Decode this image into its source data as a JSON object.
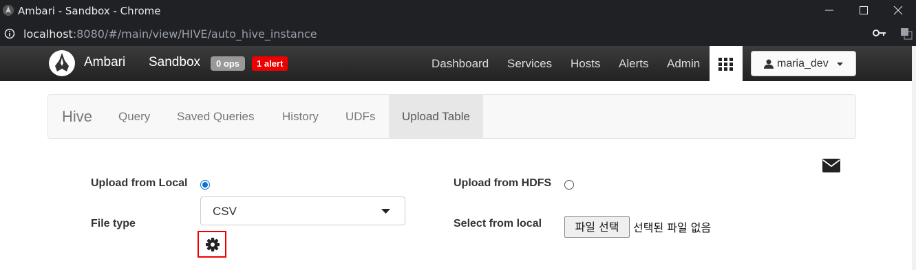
{
  "window": {
    "title": "Ambari - Sandbox - Chrome"
  },
  "browser": {
    "url_host": "localhost",
    "url_path": ":8080/#/main/view/HIVE/auto_hive_instance"
  },
  "navbar": {
    "brand": "Ambari",
    "cluster": "Sandbox",
    "ops_badge": "0 ops",
    "alert_badge": "1 alert",
    "links": [
      "Dashboard",
      "Services",
      "Hosts",
      "Alerts",
      "Admin"
    ],
    "user": "maria_dev"
  },
  "hive_nav": {
    "brand": "Hive",
    "tabs": [
      "Query",
      "Saved Queries",
      "History",
      "UDFs",
      "Upload Table"
    ],
    "active_tab": "Upload Table"
  },
  "upload": {
    "local_label": "Upload from Local",
    "local_selected": true,
    "hdfs_label": "Upload from HDFS",
    "hdfs_selected": false,
    "file_type_label": "File type",
    "file_type_value": "CSV",
    "select_local_label": "Select from local",
    "file_button": "파일 선택",
    "no_file_text": "선택된 파일 없음"
  },
  "colors": {
    "accent": "#0a72d9",
    "alert": "#ee0000",
    "highlight_box": "#ee0000"
  }
}
